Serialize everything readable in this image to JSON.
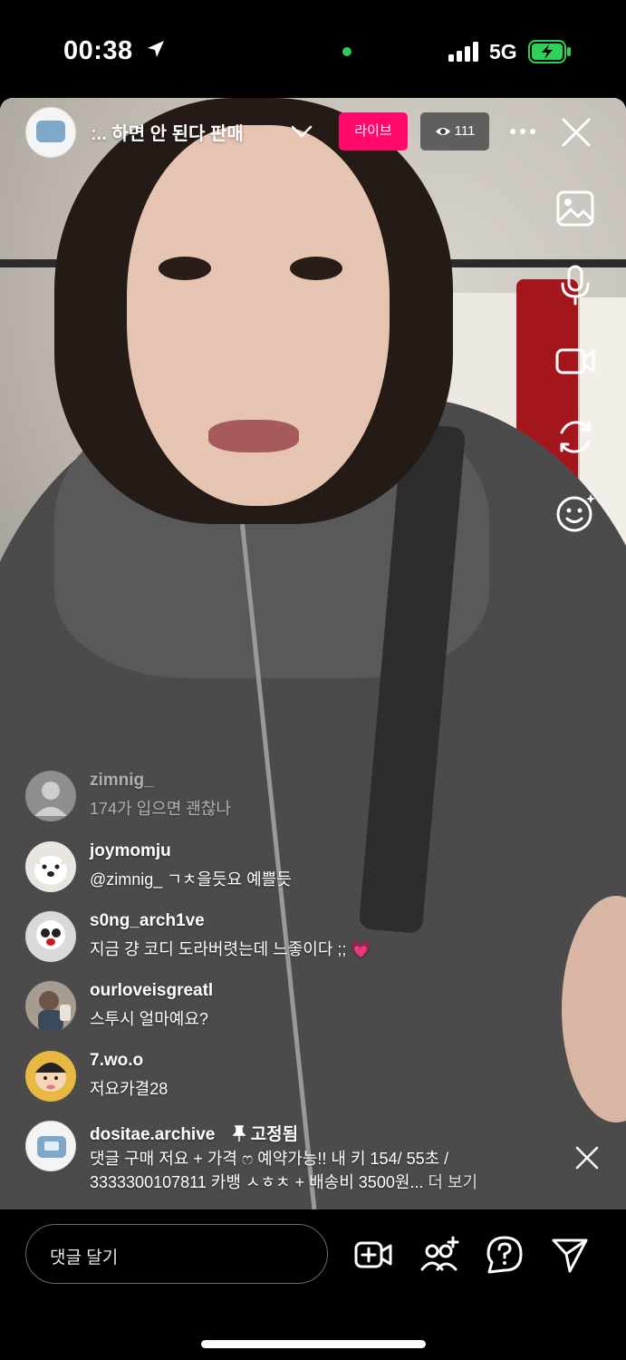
{
  "status_bar": {
    "time": "00:38",
    "network": "5G",
    "battery_charging": true
  },
  "header": {
    "title": "ː.. 하면 안 된다  판매",
    "live_label": "라이브",
    "viewer_count": "111"
  },
  "side_tools": [
    "image-icon",
    "microphone-icon",
    "video-camera-icon",
    "flip-camera-icon",
    "effects-icon"
  ],
  "comments": [
    {
      "user": "zimnig_",
      "text": "174가 입으면 괜찮나",
      "faded": true,
      "avatar": "default-avatar"
    },
    {
      "user": "joymomju",
      "text": "@zimnig_ ㄱㅊ을듯요 예쁠듯",
      "avatar": "dog-avatar"
    },
    {
      "user": "s0ng_arch1ve",
      "text": "지금 걍 코디 도라버렷는데 느좋이다 ;; 💗",
      "avatar": "figure-avatar"
    },
    {
      "user": "ourloveisgreatl",
      "text": "스투시 얼마예요?",
      "avatar": "photo-avatar"
    },
    {
      "user": "7.wo.o",
      "text": "저요카결28",
      "avatar": "cartoon-avatar"
    }
  ],
  "pinned": {
    "user": "dositae.archive",
    "pin_label": "고정됨",
    "line1": "댓글 구매 저요 + 가격 ෆ 예약가능!! 내 키 154/ 55초 /",
    "line2": "3333300107811 카뱅 ㅅㅎㅊ + 배송비 3500원...",
    "more": "더 보기"
  },
  "bottom": {
    "comment_placeholder": "댓글 달기"
  },
  "colors": {
    "live": "#ff0a6c",
    "status_green": "#34c759",
    "battery_green": "#30d158"
  }
}
